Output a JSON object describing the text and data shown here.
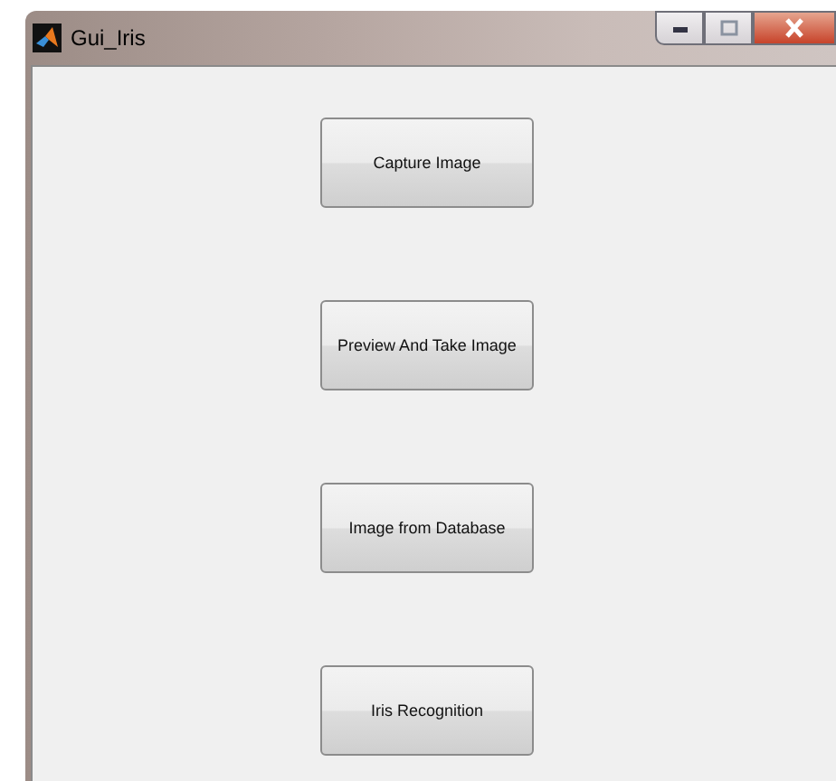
{
  "window": {
    "title": "Gui_Iris"
  },
  "buttons": [
    {
      "label": "Capture Image"
    },
    {
      "label": "Preview And Take Image"
    },
    {
      "label": "Image from Database"
    },
    {
      "label": "Iris Recognition"
    }
  ]
}
